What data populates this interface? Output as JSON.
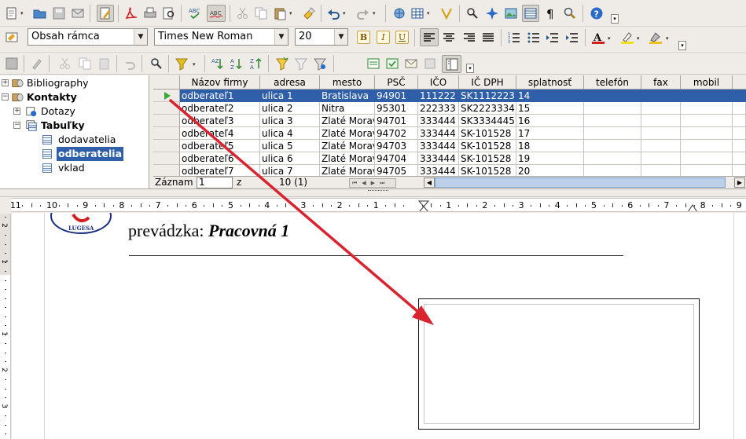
{
  "formatting": {
    "paragraph_style": "Obsah rámca",
    "font_name": "Times New Roman",
    "font_size": "20",
    "bold_label": "B",
    "italic_label": "I",
    "underline_label": "U"
  },
  "navigator": {
    "items": [
      {
        "label": "Bibliography"
      },
      {
        "label": "Kontakty"
      },
      {
        "label": "Dotazy"
      },
      {
        "label": "Tabuľky"
      },
      {
        "label": "dodavatelia"
      },
      {
        "label": "odberatelia"
      },
      {
        "label": "vklad"
      }
    ]
  },
  "grid": {
    "columns": [
      "Názov firmy",
      "adresa",
      "mesto",
      "PSČ",
      "IČO",
      "IČ DPH",
      "splatnosť",
      "telefón",
      "fax",
      "mobil"
    ],
    "rows": [
      [
        "odberateľ1",
        "ulica 1",
        "Bratislava",
        "94901",
        "111222",
        "SK1112223",
        "14"
      ],
      [
        "odberateľ2",
        "ulica 2",
        "Nitra",
        "95301",
        "222333",
        "SK2223334",
        "15"
      ],
      [
        "odberateľ3",
        "ulica 3",
        "Zlaté Moravce",
        "94701",
        "333444",
        "SK3334445",
        "16"
      ],
      [
        "odberateľ4",
        "ulica 4",
        "Zlaté Moravce",
        "94702",
        "333444",
        "SK-101528",
        "17"
      ],
      [
        "odberateľ5",
        "ulica 5",
        "Zlaté Moravce",
        "94703",
        "333444",
        "SK-101528",
        "18"
      ],
      [
        "odberateľ6",
        "ulica 6",
        "Zlaté Moravce",
        "94704",
        "333444",
        "SK-101528",
        "19"
      ],
      [
        "odberateľ7",
        "ulica 7",
        "Zlaté Moravce",
        "94705",
        "333444",
        "SK-101528",
        "20"
      ]
    ]
  },
  "record_bar": {
    "label": "Záznam",
    "current": "1",
    "of_label": "z",
    "count": "10 (1)"
  },
  "ruler": {
    "labels": [
      "11",
      "10",
      "9",
      "8",
      "7",
      "6",
      "5",
      "4",
      "3",
      "2",
      "1",
      "1",
      "2",
      "3",
      "4",
      "5",
      "6",
      "7",
      "8",
      "9"
    ]
  },
  "vruler": {
    "labels": [
      "2",
      "1",
      "1",
      "2",
      "3"
    ]
  },
  "document": {
    "line_prefix": "prevádzka: ",
    "line_emph": "Pracovná  1",
    "logo_text": "LUGESA"
  },
  "colors": {
    "selection": "#2f5fa8",
    "annotation_arrow": "#d9232e"
  }
}
